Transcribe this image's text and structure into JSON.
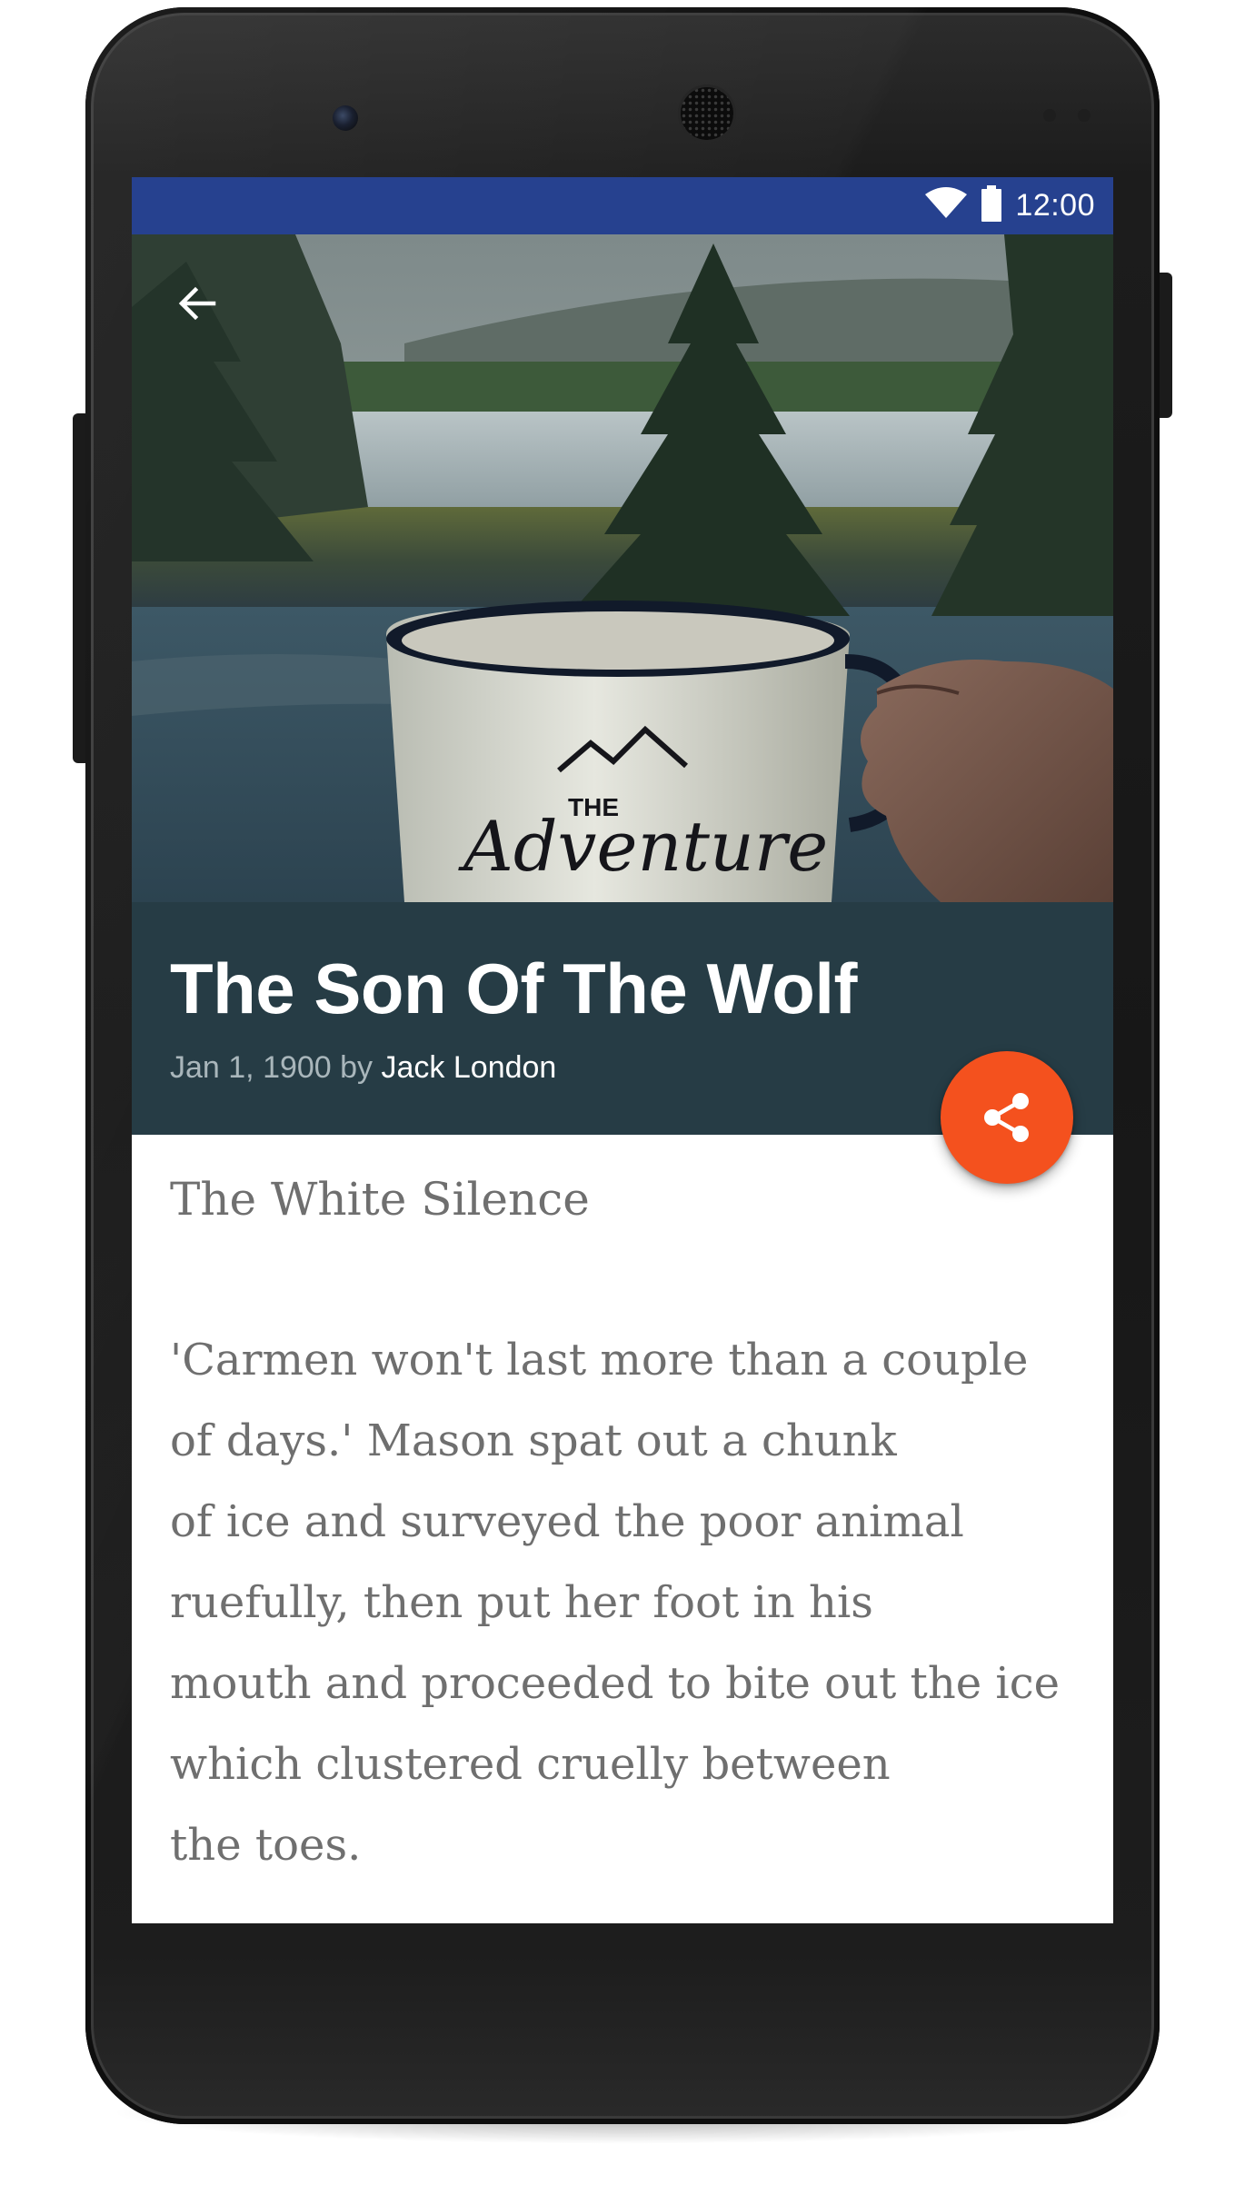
{
  "status_bar": {
    "time": "12:00",
    "background": "#26418f",
    "icons": [
      "wifi-icon",
      "battery-icon"
    ]
  },
  "toolbar": {
    "back_icon": "arrow-back-icon"
  },
  "header_image": {
    "mug_text_line1": "THE",
    "mug_text_line2": "Adventure"
  },
  "article": {
    "title": "The Son Of The Wolf",
    "date_prefix": "Jan 1, 1900 by",
    "author": "Jack London",
    "chapter": "The White Silence",
    "paragraph_lines": [
      "'Carmen won't last more than a couple",
      "of days.' Mason spat out a chunk",
      "of ice and surveyed the poor animal",
      "ruefully, then put her foot in his",
      "mouth and proceeded to bite out the ice",
      "which clustered cruelly between",
      "the toes."
    ]
  },
  "share_button": {
    "icon": "share-icon",
    "color": "#f4511e"
  },
  "colors": {
    "title_panel": "#263c45",
    "body_text": "#6f6f6f",
    "meta_text": "#a9b6bb"
  }
}
